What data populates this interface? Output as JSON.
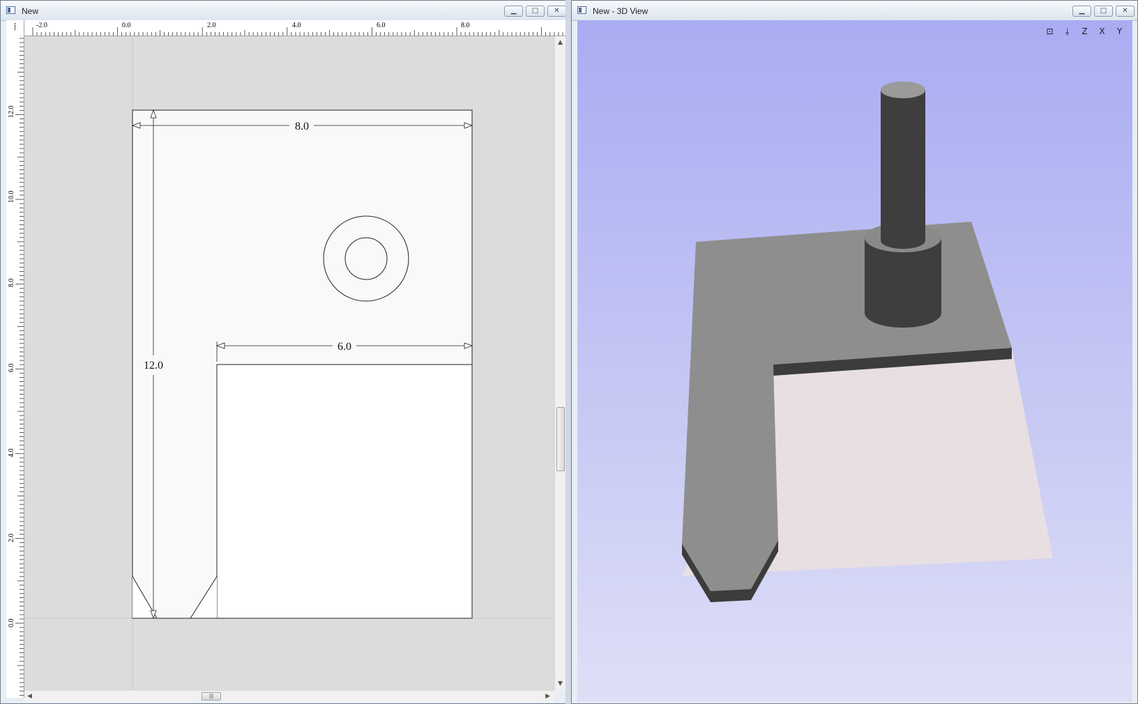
{
  "left_window": {
    "title": "New",
    "ruler_corner_icon": "origin-marker-icon",
    "ruler_h_labels": [
      "-2.0",
      "0.0",
      "2.0",
      "4.0",
      "6.0",
      "8.0"
    ],
    "ruler_v_labels": [
      "12.0",
      "10.0",
      "8.0",
      "6.0",
      "4.0",
      "2.0",
      "0.0"
    ],
    "dimensions": {
      "width": "8.0",
      "height": "12.0",
      "inner_width": "6.0"
    },
    "scroll": {
      "up": "▲",
      "down": "▼",
      "left": "◀",
      "right": "▶",
      "grip": "|||"
    }
  },
  "right_window": {
    "title": "New - 3D View",
    "view_icons": [
      "zoom-extents-icon",
      "iso-view-icon",
      "top-view-icon",
      "front-view-icon",
      "side-view-icon"
    ],
    "view_glyphs": [
      "⊡",
      "⤓",
      "Z",
      "X",
      "Y"
    ]
  },
  "window_buttons": {
    "minimize": "▁",
    "maximize": "□",
    "close": "✕"
  },
  "colors": {
    "sheet": "#f9f9f9",
    "pocket": "#ffffff",
    "model_top": "#8e8e8e",
    "model_side": "#3c3c3c",
    "material": "#e8dfe3",
    "sky_top": "#a9acf2",
    "sky_bottom": "#dedff6"
  }
}
